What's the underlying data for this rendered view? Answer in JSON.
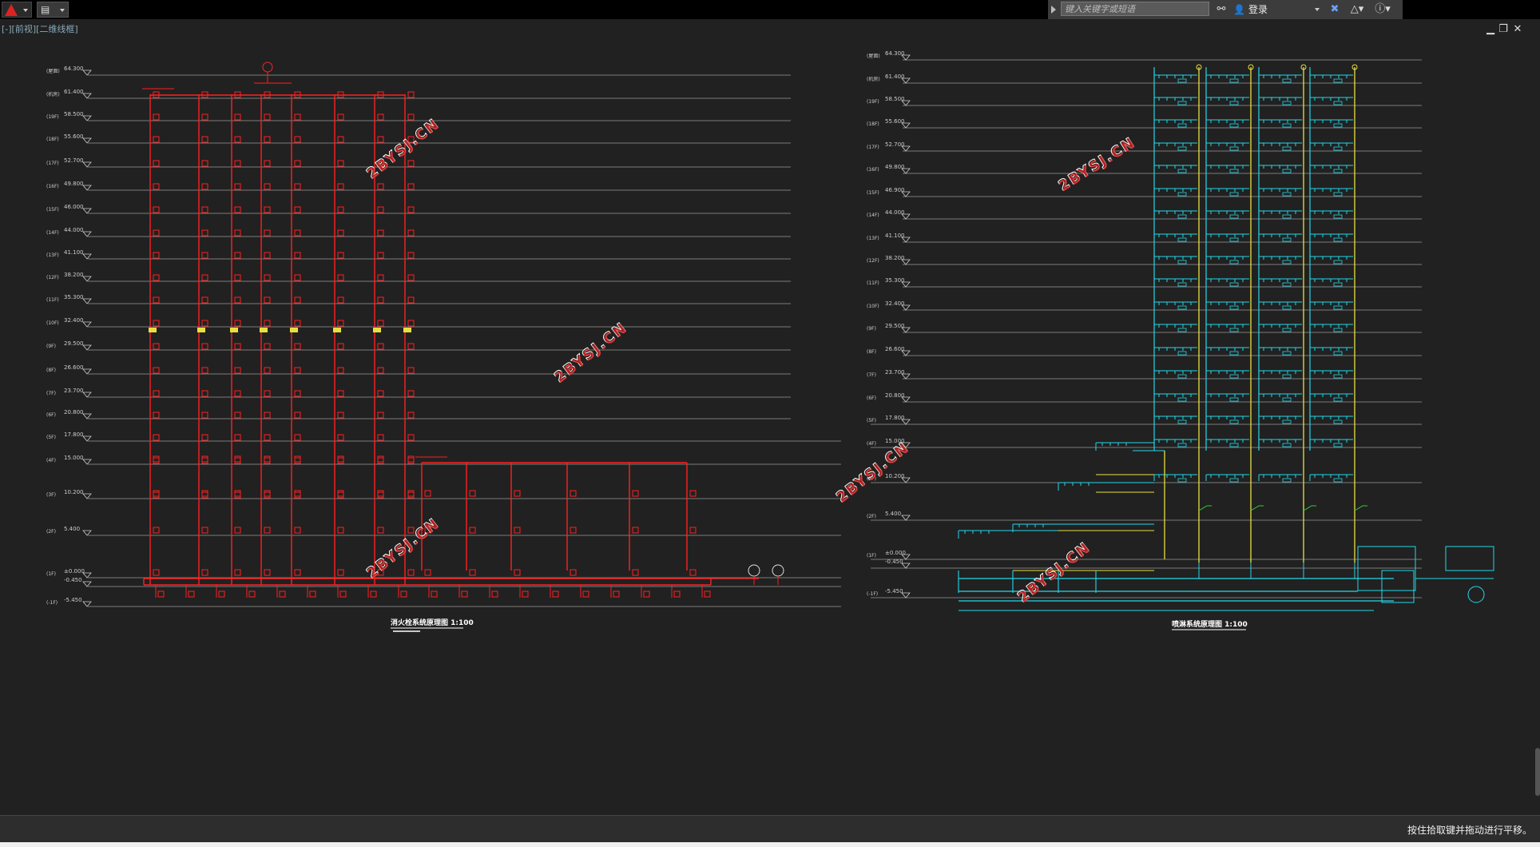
{
  "toolbar": {
    "search_placeholder": "键入关键字或短语",
    "login_label": "登录",
    "help_icon": "help-icon",
    "exchange_icon": "exchange-icon",
    "binoculars_icon": "binoculars-icon",
    "user_icon": "user-icon",
    "a360_icon": "a360-icon"
  },
  "viewport": {
    "label": "[-][前视][二维线框]"
  },
  "drawing": {
    "watermark": "2BYSJ.CN",
    "left_title": "消火栓系统原理图  1:100",
    "right_title": "喷淋系统原理图  1:100",
    "left_levels": [
      {
        "tag": "(屋面)",
        "elev": "64.300"
      },
      {
        "tag": "(机房)",
        "elev": "61.400"
      },
      {
        "tag": "(19F)",
        "elev": "58.500"
      },
      {
        "tag": "(18F)",
        "elev": "55.600"
      },
      {
        "tag": "(17F)",
        "elev": "52.700"
      },
      {
        "tag": "(16F)",
        "elev": "49.800"
      },
      {
        "tag": "(15F)",
        "elev": "46.000"
      },
      {
        "tag": "(14F)",
        "elev": "44.000"
      },
      {
        "tag": "(13F)",
        "elev": "41.100"
      },
      {
        "tag": "(12F)",
        "elev": "38.200"
      },
      {
        "tag": "(11F)",
        "elev": "35.300"
      },
      {
        "tag": "(10F)",
        "elev": "32.400"
      },
      {
        "tag": "(9F)",
        "elev": "29.500"
      },
      {
        "tag": "(8F)",
        "elev": "26.600"
      },
      {
        "tag": "(7F)",
        "elev": "23.700"
      },
      {
        "tag": "(6F)",
        "elev": "20.800"
      },
      {
        "tag": "(5F)",
        "elev": "17.800"
      },
      {
        "tag": "(4F)",
        "elev": "15.000"
      },
      {
        "tag": "(3F)",
        "elev": "10.200"
      },
      {
        "tag": "(2F)",
        "elev": "5.400"
      },
      {
        "tag": "(1F)",
        "elev": "±0.000"
      },
      {
        "tag": "",
        "elev": "-0.450"
      },
      {
        "tag": "(-1F)",
        "elev": "-5.450"
      }
    ],
    "right_levels": [
      {
        "tag": "(屋面)",
        "elev": "64.300"
      },
      {
        "tag": "(机房)",
        "elev": "61.400"
      },
      {
        "tag": "(19F)",
        "elev": "58.500"
      },
      {
        "tag": "(18F)",
        "elev": "55.600"
      },
      {
        "tag": "(17F)",
        "elev": "52.700"
      },
      {
        "tag": "(16F)",
        "elev": "49.800"
      },
      {
        "tag": "(15F)",
        "elev": "46.900"
      },
      {
        "tag": "(14F)",
        "elev": "44.000"
      },
      {
        "tag": "(13F)",
        "elev": "41.100"
      },
      {
        "tag": "(12F)",
        "elev": "38.200"
      },
      {
        "tag": "(11F)",
        "elev": "35.300"
      },
      {
        "tag": "(10F)",
        "elev": "32.400"
      },
      {
        "tag": "(9F)",
        "elev": "29.500"
      },
      {
        "tag": "(8F)",
        "elev": "26.600"
      },
      {
        "tag": "(7F)",
        "elev": "23.700"
      },
      {
        "tag": "(6F)",
        "elev": "20.800"
      },
      {
        "tag": "(5F)",
        "elev": "17.800"
      },
      {
        "tag": "(4F)",
        "elev": "15.000"
      },
      {
        "tag": "(3F)",
        "elev": "10.200"
      },
      {
        "tag": "(2F)",
        "elev": "5.400"
      },
      {
        "tag": "(1F)",
        "elev": "±0.000"
      },
      {
        "tag": "",
        "elev": "-0.450"
      },
      {
        "tag": "(-1F)",
        "elev": "-5.450"
      }
    ]
  },
  "status": {
    "hint": "按住拾取键并拖动进行平移。"
  },
  "colors": {
    "canvas_bg": "#212121",
    "hydrant": "#ff2020",
    "sprinkler": "#22d8e8",
    "riser_yellow": "#e8e040",
    "level_line": "#9a9a9a",
    "watermark": "#ffffff"
  }
}
